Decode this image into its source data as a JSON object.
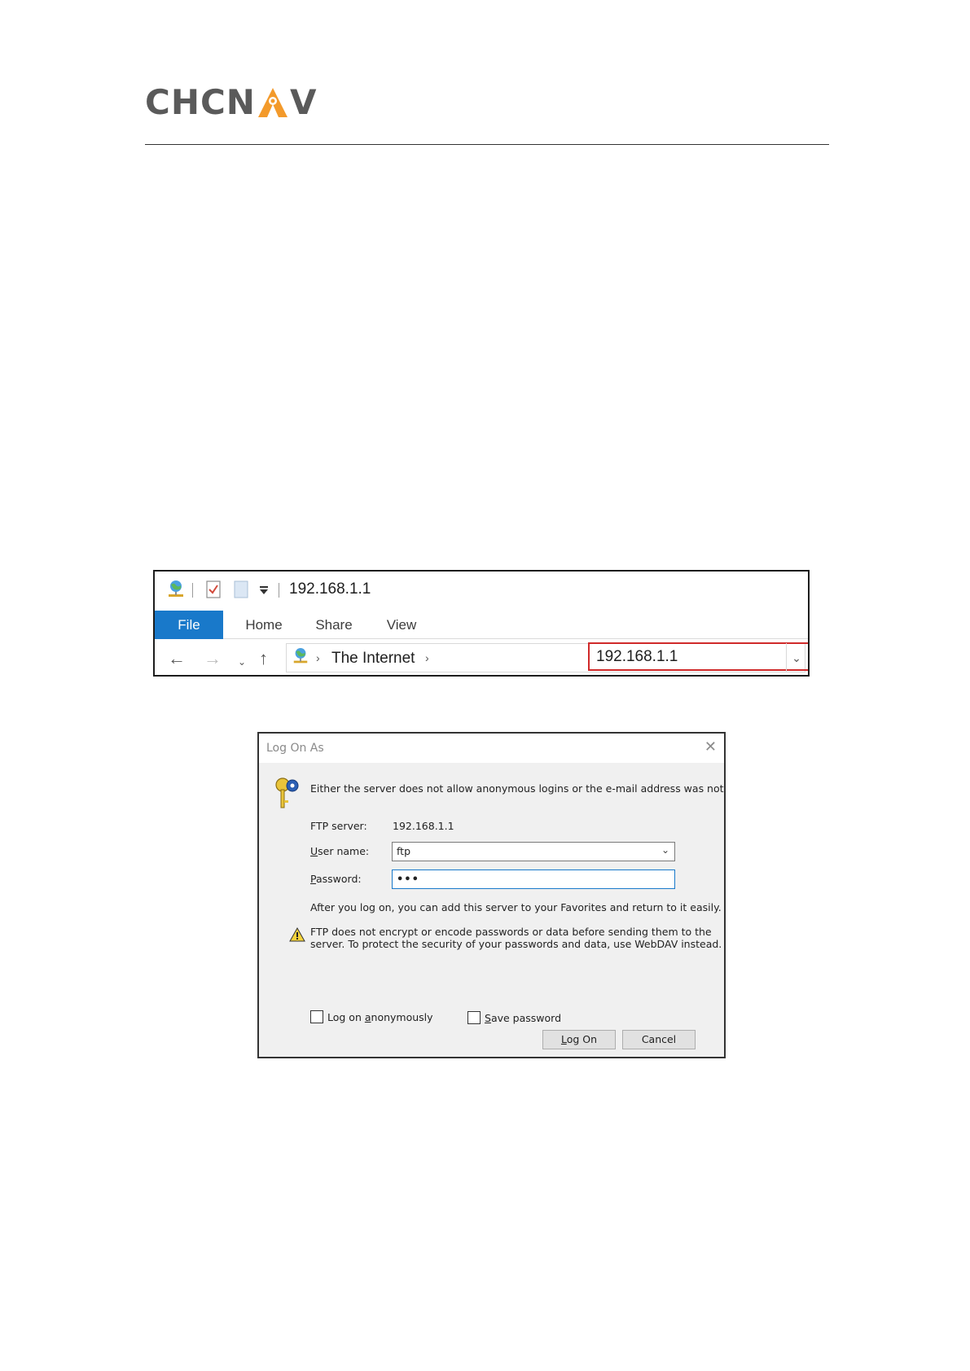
{
  "header": {
    "logo_text_left": "CHCN",
    "logo_text_right": "V",
    "brand_color": "#5a5a5a",
    "accent_color": "#f39a2b"
  },
  "explorer": {
    "qat_icons": [
      "network-globe-icon",
      "properties-check-icon",
      "new-folder-icon",
      "customize-dropdown-icon"
    ],
    "window_title": "192.168.1.1",
    "tabs": [
      "File",
      "Home",
      "Share",
      "View"
    ],
    "breadcrumb": [
      "The Internet"
    ],
    "address_value": "192.168.1.1",
    "active_tab_color": "#1979ca",
    "highlight_color": "#d02a2a"
  },
  "dialog": {
    "title": "Log On As",
    "message": "Either the server does not allow anonymous logins or the e-mail address was not accepted.",
    "ftp_server_label": "FTP server:",
    "ftp_server_value": "192.168.1.1",
    "username_label_u": "U",
    "username_label_rest": "ser name:",
    "username_value": "ftp",
    "password_label_u": "P",
    "password_label_rest": "assword:",
    "password_value": "•••",
    "info_text": "After you log on, you can add this server to your Favorites and return to it easily.",
    "warning_line1": "FTP does not encrypt or encode passwords or data before sending them to the",
    "warning_line2": "server.  To protect the security of your passwords and data, use WebDAV instead.",
    "anonymous_label_pre": "Log on ",
    "anonymous_label_u": "a",
    "anonymous_label_rest": "nonymously",
    "save_label_u": "S",
    "save_label_rest": "ave password",
    "logon_button_u": "L",
    "logon_button_rest": "og On",
    "cancel_button": "Cancel",
    "anonymous_checked": false,
    "save_password_checked": false
  }
}
